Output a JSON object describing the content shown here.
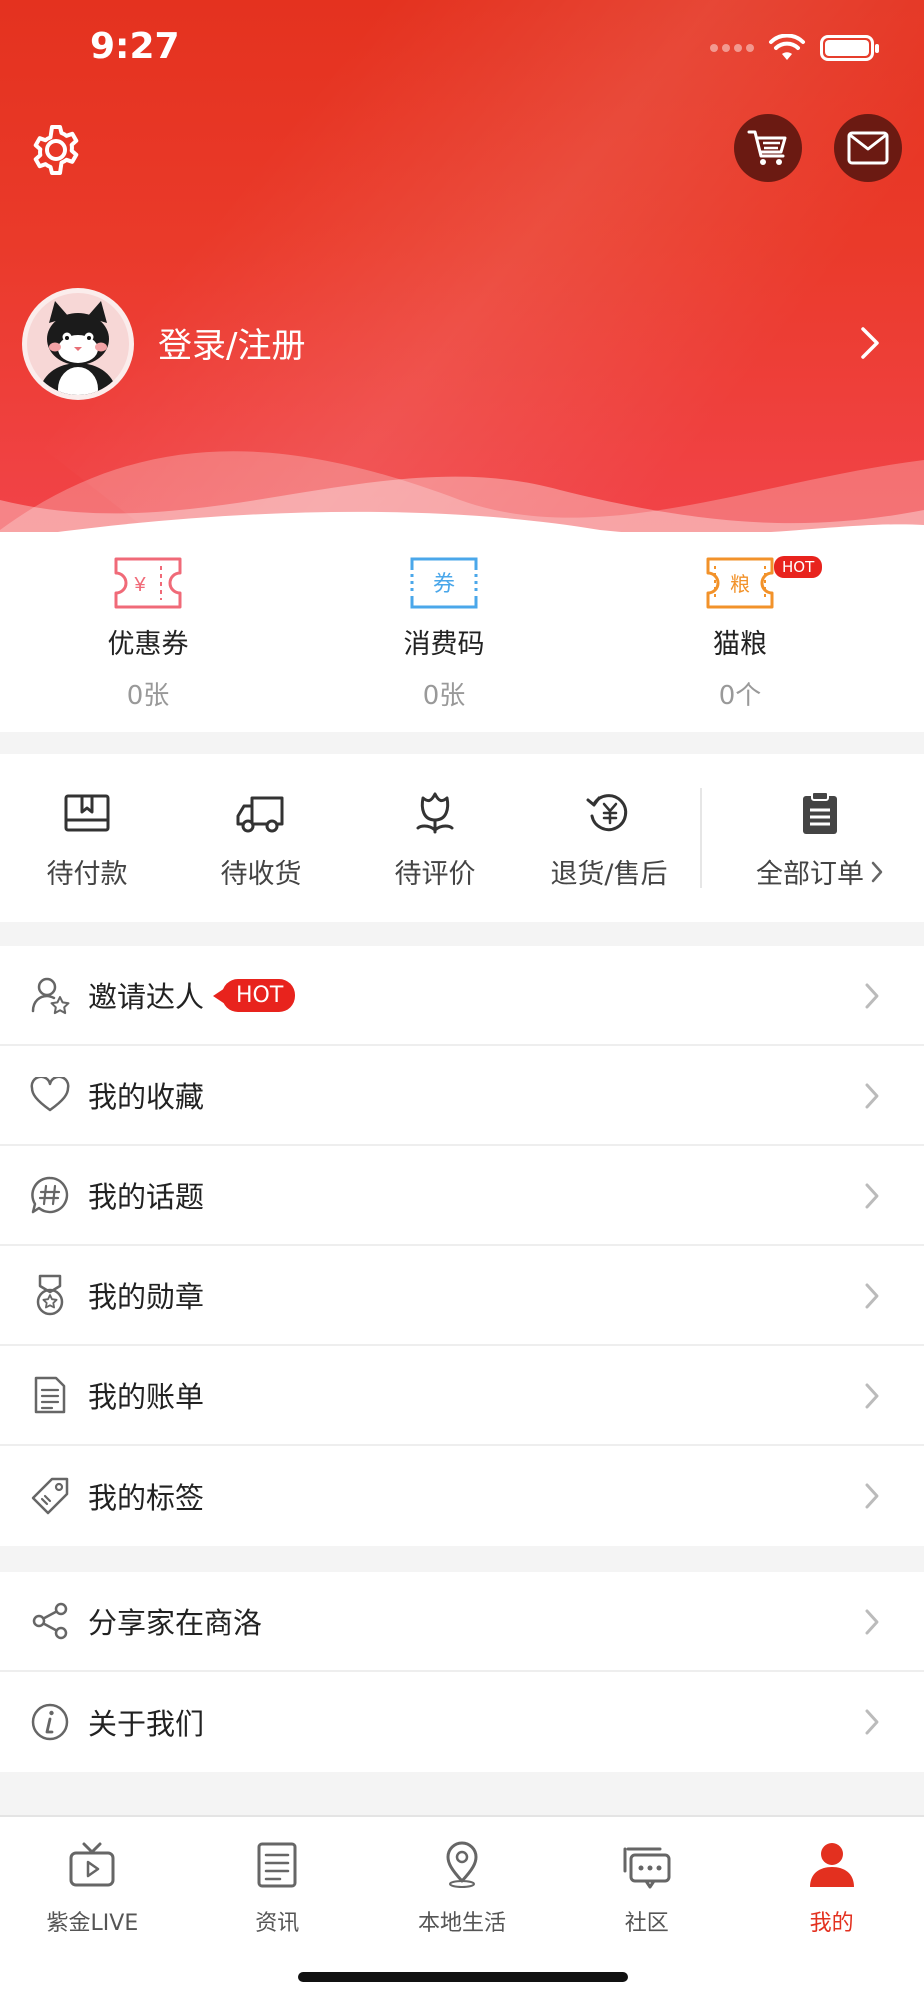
{
  "status_bar": {
    "time": "9:27"
  },
  "profile": {
    "login_label": "登录/注册"
  },
  "assets": [
    {
      "name": "优惠券",
      "value": "0张",
      "icon": "coupon-icon"
    },
    {
      "name": "消费码",
      "value": "0张",
      "icon": "voucher-icon"
    },
    {
      "name": "猫粮",
      "value": "0个",
      "icon": "cat-food-icon",
      "badge": "HOT"
    }
  ],
  "asset_icon_glyphs": {
    "coupon": "¥",
    "voucher": "券",
    "cat_food": "粮"
  },
  "orders": [
    {
      "label": "待付款",
      "icon": "pending-payment-icon"
    },
    {
      "label": "待收货",
      "icon": "truck-icon"
    },
    {
      "label": "待评价",
      "icon": "review-icon"
    },
    {
      "label": "退货/售后",
      "icon": "refund-icon"
    }
  ],
  "orders_all": {
    "label": "全部订单",
    "icon": "clipboard-icon"
  },
  "menu_group1": [
    {
      "label": "邀请达人",
      "icon": "invite-user-icon",
      "badge": "HOT"
    },
    {
      "label": "我的收藏",
      "icon": "heart-icon"
    },
    {
      "label": "我的话题",
      "icon": "topic-icon"
    },
    {
      "label": "我的勋章",
      "icon": "medal-icon"
    },
    {
      "label": "我的账单",
      "icon": "bill-icon"
    },
    {
      "label": "我的标签",
      "icon": "tag-icon"
    }
  ],
  "menu_group2": [
    {
      "label": "分享家在商洛",
      "icon": "share-icon"
    },
    {
      "label": "关于我们",
      "icon": "info-icon"
    }
  ],
  "tabs": [
    {
      "label": "紫金LIVE",
      "icon": "tv-icon"
    },
    {
      "label": "资讯",
      "icon": "news-icon"
    },
    {
      "label": "本地生活",
      "icon": "location-icon"
    },
    {
      "label": "社区",
      "icon": "chat-icon"
    },
    {
      "label": "我的",
      "icon": "user-icon",
      "active": true
    }
  ],
  "colors": {
    "brand_red": "#e3301f",
    "hot_red": "#e8231d",
    "coupon_pink": "#f06a78",
    "voucher_blue": "#4aa7ea",
    "catfood_orange": "#f2922a"
  }
}
